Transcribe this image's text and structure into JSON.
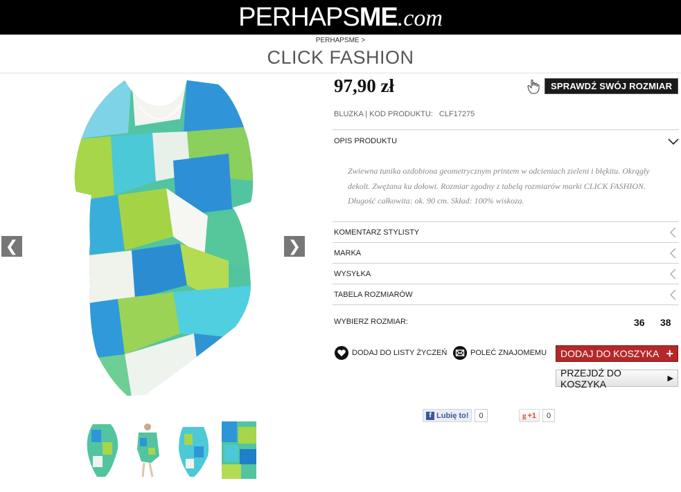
{
  "header": {
    "logo_part1": "PERHAPS",
    "logo_part2": "ME",
    "logo_part3": ".com"
  },
  "breadcrumb": {
    "home": "PERHAPSME",
    "separator": ">"
  },
  "brand_title": "CLICK FASHION",
  "gallery": {
    "prev_label": "❮",
    "next_label": "❯",
    "thumbnail_count": 4
  },
  "product": {
    "price": "97,90 zł",
    "size_check_button": "SPRAWDŹ SWÓJ ROZMIAR",
    "code_label": "BLUZKA | KOD PRODUKTU:",
    "code_value": "CLF17275",
    "description": "Zwiewna tunika ozdobiona geometrycznym printem w odcieniach zieleni i błękitu. Okrągły dekolt. Zwężana ku dołowi. Rozmiar zgodny z tabelą rozmiarów marki CLICK FASHION. Długość całkowita: ok. 90 cm. Skład: 100% wiskoza."
  },
  "accordion": {
    "open_section": "OPIS PRODUKTU",
    "sections": [
      "KOMENTARZ STYLISTY",
      "MARKA",
      "WYSYŁKA",
      "TABELA ROZMIARÓW"
    ]
  },
  "sizes": {
    "label": "WYBIERZ ROZMIAR:",
    "options": [
      "36",
      "38"
    ]
  },
  "actions": {
    "wishlist": "DODAJ DO LISTY ŻYCZEŃ",
    "recommend": "POLEĆ ZNAJOMEMU",
    "add_to_cart": "DODAJ DO KOSZYKA",
    "add_to_cart_icon": "+",
    "go_to_cart": "PRZEJDŹ DO KOSZYKA",
    "go_to_cart_icon": "▶"
  },
  "social": {
    "facebook_label": "Lubię to!",
    "facebook_count": "0",
    "gplus_label": "+1",
    "gplus_count": "0"
  },
  "colors": {
    "topbar": "#000000",
    "cart_button": "#b52828",
    "facebook": "#3b5998",
    "gplus": "#dd4b39"
  }
}
